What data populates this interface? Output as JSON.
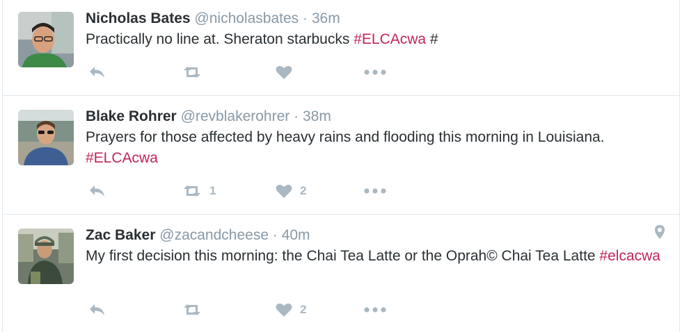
{
  "colors": {
    "hashtag": "#c0255b",
    "muted": "#8899a6",
    "action_icon": "#aab8c2",
    "divider": "#e1e8ed"
  },
  "tweets": [
    {
      "fullname": "Nicholas Bates",
      "username": "@nicholasbates",
      "separator": "·",
      "time": "36m",
      "text_before": "Practically no line at. Sheraton starbucks ",
      "hashtag": "#ELCAcwa",
      "text_after": " #",
      "retweets": "",
      "likes": "",
      "has_geo": false
    },
    {
      "fullname": "Blake Rohrer",
      "username": "@revblakerohrer",
      "separator": "·",
      "time": "38m",
      "text_before": "Prayers for those affected by heavy rains and flooding this morning in Louisiana. ",
      "hashtag": "#ELCAcwa",
      "text_after": "",
      "retweets": "1",
      "likes": "2",
      "has_geo": false
    },
    {
      "fullname": "Zac Baker",
      "username": "@zacandcheese",
      "separator": "·",
      "time": "40m",
      "text_before": "My first decision this morning: the Chai Tea Latte or the Oprah© Chai Tea Latte ",
      "hashtag": "#elcacwa",
      "text_after": "",
      "retweets": "",
      "likes": "2",
      "has_geo": true
    }
  ],
  "icons": {
    "reply": "reply-icon",
    "retweet": "retweet-icon",
    "like": "heart-icon",
    "more": "more-dots-icon",
    "geo": "location-pin-icon"
  }
}
